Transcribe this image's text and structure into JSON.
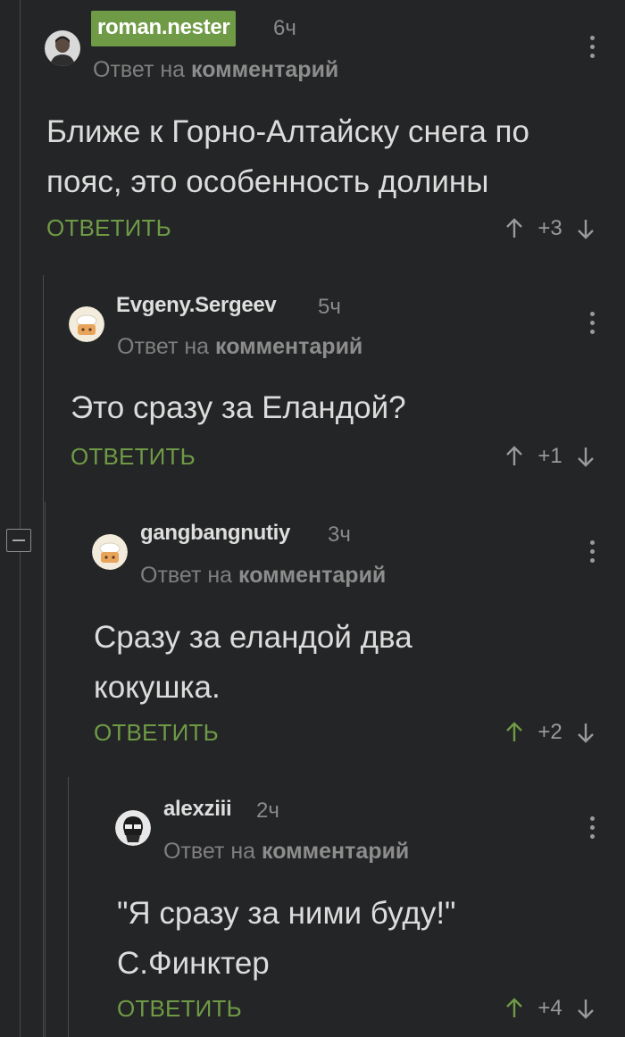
{
  "comments": [
    {
      "author": "roman.nester",
      "time": "6ч",
      "reply_prefix": "Ответ на",
      "reply_target": "комментарий",
      "text_lines": [
        "Ближе к Горно-Алтайску снега по",
        "пояс, это особенность долины"
      ],
      "reply_label": "ОТВЕТИТЬ",
      "score": "+3",
      "upvoted": false,
      "highlight": true,
      "avatar": "avatar-photo"
    },
    {
      "author": "Evgeny.Sergeev",
      "time": "5ч",
      "reply_prefix": "Ответ на",
      "reply_target": "комментарий",
      "text_lines": [
        "Это сразу за Еландой?"
      ],
      "reply_label": "ОТВЕТИТЬ",
      "score": "+1",
      "upvoted": false,
      "highlight": false,
      "avatar": "avatar-default"
    },
    {
      "author": "gangbangnutiy",
      "time": "3ч",
      "reply_prefix": "Ответ на",
      "reply_target": "комментарий",
      "text_lines": [
        "Сразу за еландой два",
        "кокушка."
      ],
      "reply_label": "ОТВЕТИТЬ",
      "score": "+2",
      "upvoted": true,
      "highlight": false,
      "avatar": "avatar-default"
    },
    {
      "author": "alexziii",
      "time": "2ч",
      "reply_prefix": "Ответ на",
      "reply_target": "комментарий",
      "text_lines": [
        "\"Я сразу за ними буду!\"",
        "С.Финктер"
      ],
      "reply_label": "ОТВЕТИТЬ",
      "score": "+4",
      "upvoted": true,
      "highlight": false,
      "avatar": "avatar-skull"
    }
  ],
  "colors": {
    "background": "#242526",
    "accent_green": "#6f9a46",
    "text": "#dcdcdc",
    "muted": "#8a8a8a"
  }
}
